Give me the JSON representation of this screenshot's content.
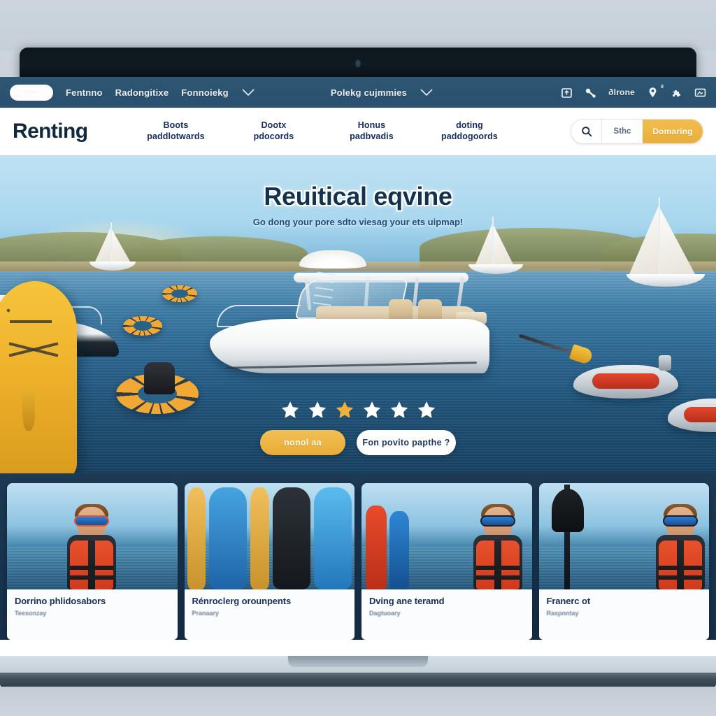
{
  "browser": {
    "tab_label": "·········",
    "links": [
      "Fentnno",
      "Radongitixe",
      "Fonnoiekg",
      "Polekg cujmmies"
    ],
    "chevron_icon": "chevron-down-icon",
    "toolbar_icons": [
      {
        "name": "upload-box-icon",
        "glyph": "box"
      },
      {
        "name": "key-icon",
        "glyph": "key"
      },
      {
        "name": "puzzle-icon",
        "glyph": "puzzle"
      },
      {
        "name": "window-icon",
        "glyph": "window"
      }
    ],
    "toolbar_text": "ðlrone",
    "pin_icon": "location-pin-icon",
    "pin_badge": "8"
  },
  "site": {
    "logo": "Renting",
    "nav": [
      {
        "line1": "Boots",
        "line2": "paddlotwards"
      },
      {
        "line1": "Dootx",
        "line2": "pdocords"
      },
      {
        "line1": "Honus",
        "line2": "padbvadis"
      },
      {
        "line1": "doting",
        "line2": "paddogoords"
      }
    ],
    "search": {
      "icon": "search-icon",
      "value": "Sthc",
      "cta_label": "Domaring"
    }
  },
  "hero": {
    "title": "Reuitical eqvine",
    "subtitle": "Go dong your pore sdto viesag your ets uipmap!",
    "rating": {
      "total": 6,
      "filled_index": 2,
      "filled_color": "#f0b03c",
      "empty_color": "#ffffff"
    },
    "primary_button": "nonol aa",
    "secondary_button": "Fon povito papthe ?"
  },
  "cards": [
    {
      "title": "Dorrino phlidosabors",
      "subtitle": "Teesonzay",
      "image": "diver-photo"
    },
    {
      "title": "Rénroclerg orounpents",
      "subtitle": "Pranaary",
      "image": "paddleboards-photo"
    },
    {
      "title": "Dving ane teramd",
      "subtitle": "Dagtuoary",
      "image": "kayaks-diver-photo"
    },
    {
      "title": "Franerc ot",
      "subtitle": "Raspnntay",
      "image": "paddler-photo"
    }
  ],
  "colors": {
    "chrome_blue": "#2b5370",
    "navy": "#10293f",
    "gold": "#e8ab35",
    "strip_bg": "#1d3a55"
  }
}
